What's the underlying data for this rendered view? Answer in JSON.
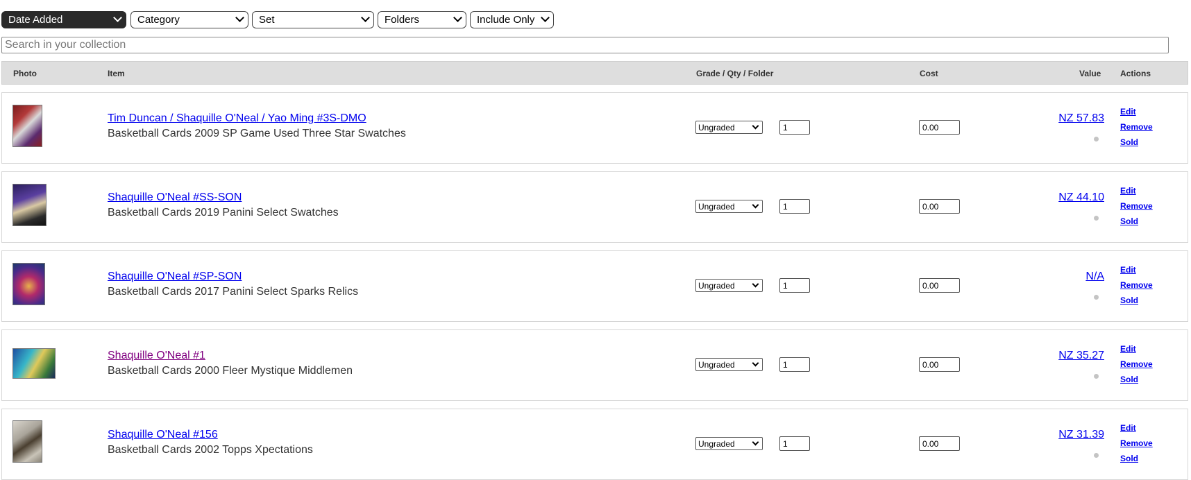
{
  "filters": {
    "sort": "Date Added",
    "category": "Category",
    "set": "Set",
    "folders": "Folders",
    "include": "Include Only"
  },
  "search": {
    "placeholder": "Search in your collection"
  },
  "table": {
    "headers": {
      "photo": "Photo",
      "item": "Item",
      "grade_qty_folder": "Grade / Qty / Folder",
      "cost": "Cost",
      "value": "Value",
      "actions": "Actions"
    },
    "rows": [
      {
        "title": "Tim Duncan / Shaquille O'Neal / Yao Ming #3S-DMO",
        "subtitle": "Basketball Cards 2009 SP Game Used Three Star Swatches",
        "grade": "Ungraded",
        "qty": "1",
        "cost": "0.00",
        "value": "NZ 57.83",
        "visited": false
      },
      {
        "title": "Shaquille O'Neal #SS-SON",
        "subtitle": "Basketball Cards 2019 Panini Select Swatches",
        "grade": "Ungraded",
        "qty": "1",
        "cost": "0.00",
        "value": "NZ 44.10",
        "visited": false
      },
      {
        "title": "Shaquille O'Neal #SP-SON",
        "subtitle": "Basketball Cards 2017 Panini Select Sparks Relics",
        "grade": "Ungraded",
        "qty": "1",
        "cost": "0.00",
        "value": "N/A",
        "visited": false
      },
      {
        "title": "Shaquille O'Neal #1",
        "subtitle": "Basketball Cards 2000 Fleer Mystique Middlemen",
        "grade": "Ungraded",
        "qty": "1",
        "cost": "0.00",
        "value": "NZ 35.27",
        "visited": true
      },
      {
        "title": "Shaquille O'Neal #156",
        "subtitle": "Basketball Cards 2002 Topps Xpectations",
        "grade": "Ungraded",
        "qty": "1",
        "cost": "0.00",
        "value": "NZ 31.39",
        "visited": false
      }
    ],
    "actions": {
      "edit": "Edit",
      "remove": "Remove",
      "sold": "Sold"
    }
  },
  "colors": {
    "link": "#0000ee",
    "visited_link": "#800080",
    "header_bg": "#dedede",
    "dark_select": "#2a2a2a"
  }
}
